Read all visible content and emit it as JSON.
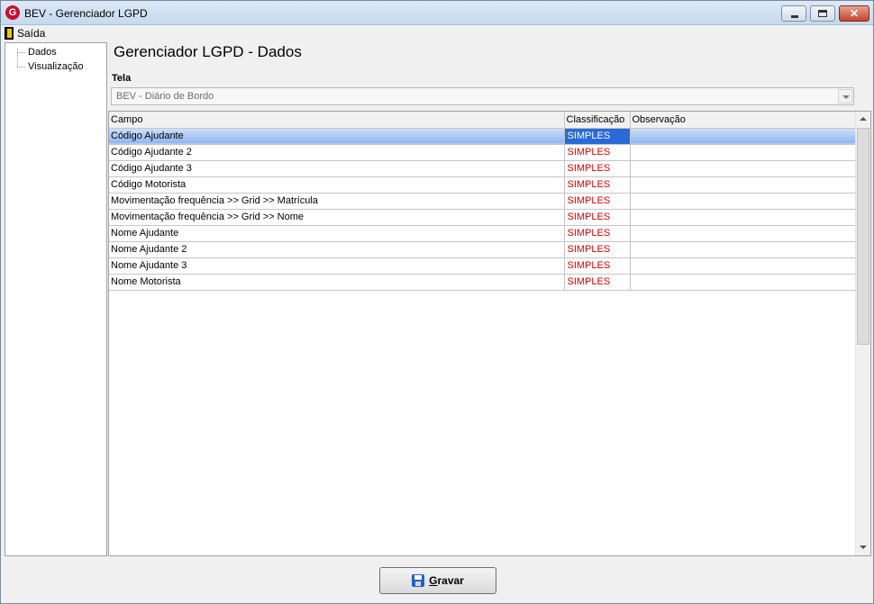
{
  "window": {
    "title": "BEV - Gerenciador LGPD",
    "app_icon_letter": "G",
    "app_icon_color": "#c8102e"
  },
  "menu": {
    "exit_label": "Saída"
  },
  "tree": {
    "items": [
      {
        "label": "Dados"
      },
      {
        "label": "Visualização"
      }
    ]
  },
  "main": {
    "title": "Gerenciador LGPD - Dados",
    "tela_label": "Tela",
    "tela_value": "BEV - Diário de Bordo"
  },
  "grid": {
    "columns": [
      "Campo",
      "Classificação",
      "Observação"
    ],
    "selected_row": 0,
    "rows": [
      {
        "campo": "Código Ajudante",
        "classificacao": "SIMPLES",
        "observacao": ""
      },
      {
        "campo": "Código Ajudante 2",
        "classificacao": "SIMPLES",
        "observacao": ""
      },
      {
        "campo": "Código Ajudante 3",
        "classificacao": "SIMPLES",
        "observacao": ""
      },
      {
        "campo": "Código Motorista",
        "classificacao": "SIMPLES",
        "observacao": ""
      },
      {
        "campo": "Movimentação frequência >> Grid >> Matrícula",
        "classificacao": "SIMPLES",
        "observacao": ""
      },
      {
        "campo": "Movimentação frequência >> Grid >> Nome",
        "classificacao": "SIMPLES",
        "observacao": ""
      },
      {
        "campo": "Nome Ajudante",
        "classificacao": "SIMPLES",
        "observacao": ""
      },
      {
        "campo": "Nome Ajudante 2",
        "classificacao": "SIMPLES",
        "observacao": ""
      },
      {
        "campo": "Nome Ajudante 3",
        "classificacao": "SIMPLES",
        "observacao": ""
      },
      {
        "campo": "Nome Motorista",
        "classificacao": "SIMPLES",
        "observacao": ""
      }
    ]
  },
  "footer": {
    "save_label": "Gravar"
  },
  "colors": {
    "classification_text": "#d40000",
    "selection": "#2a6ad8"
  },
  "icons": {
    "exit": "exit-door-icon",
    "save": "floppy-disk-icon",
    "minimize": "minimize-icon",
    "maximize": "maximize-icon",
    "close": "close-icon"
  }
}
